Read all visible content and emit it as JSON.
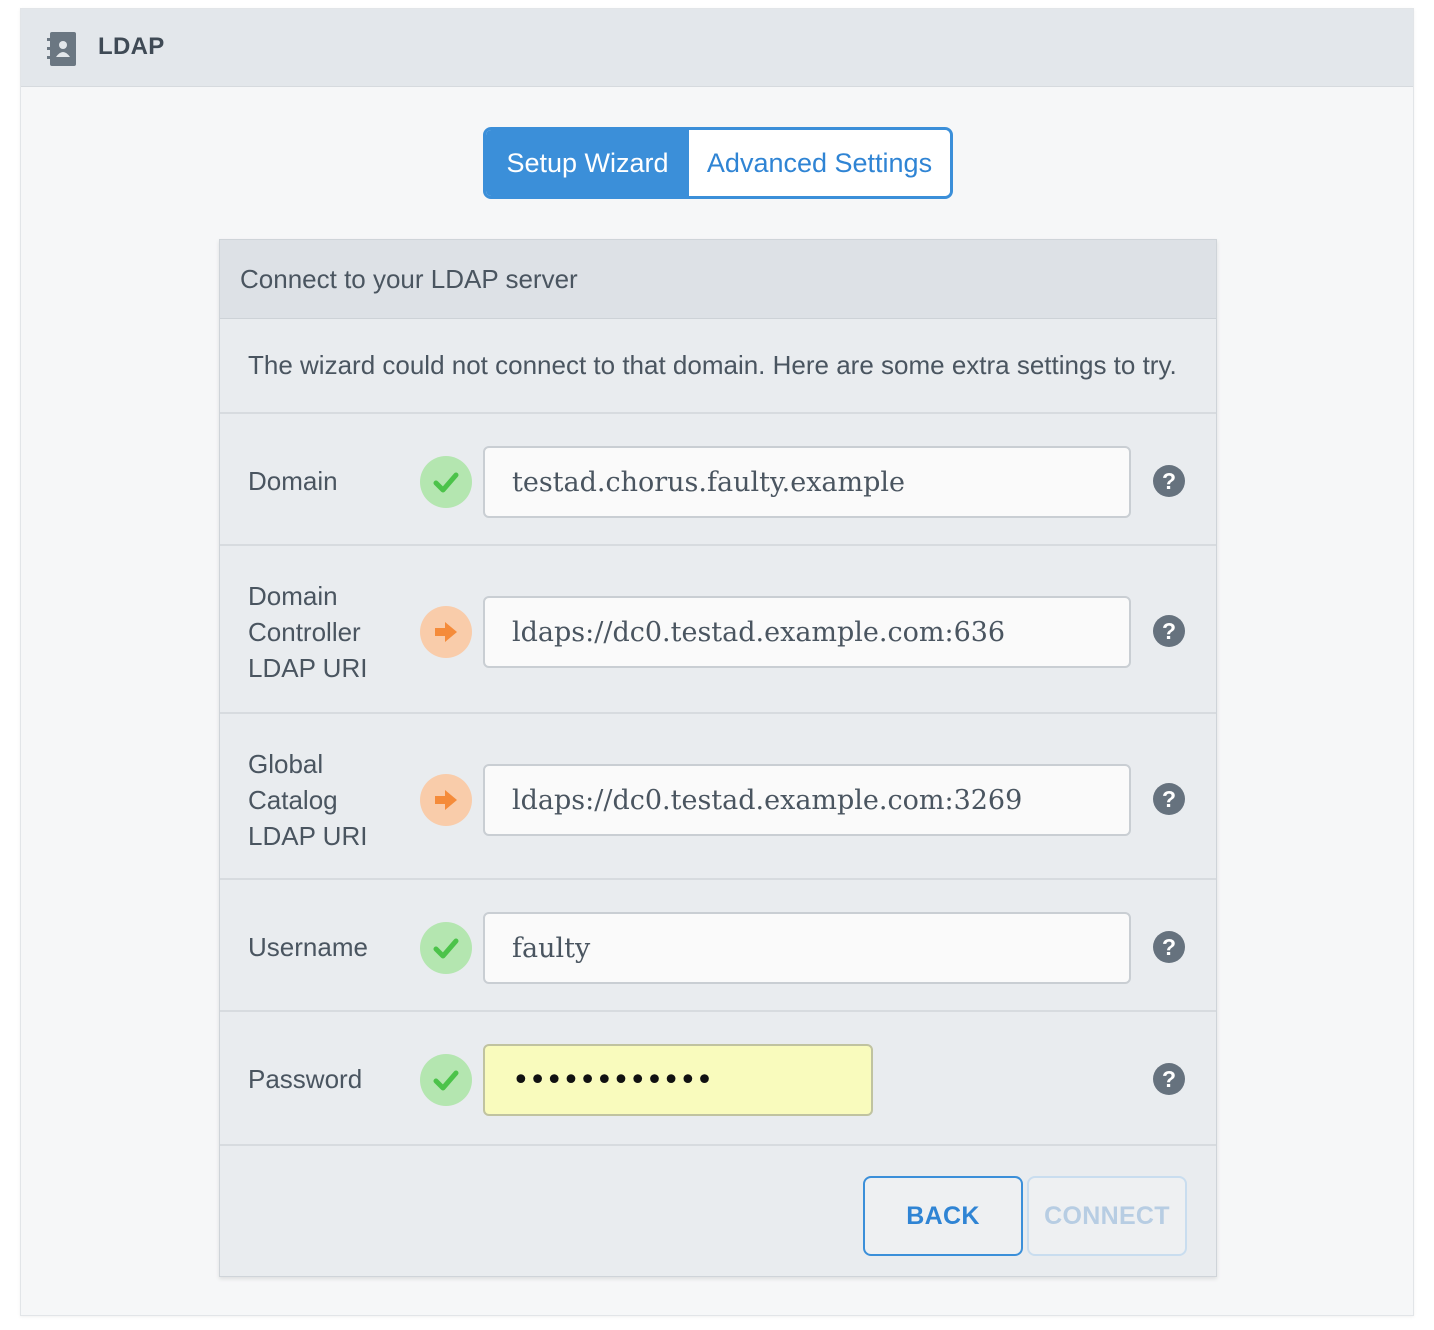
{
  "header": {
    "title": "LDAP",
    "icon": "address-book-icon"
  },
  "tabs": {
    "active_label": "Setup Wizard",
    "inactive_label": "Advanced Settings"
  },
  "panel": {
    "title": "Connect to your LDAP server",
    "message": "The wizard could not connect to that domain. Here are some extra settings to try."
  },
  "fields": {
    "domain": {
      "label": "Domain",
      "value": "testad.chorus.faulty.example",
      "status": "ok"
    },
    "dc_uri": {
      "label_lines": [
        "Domain",
        "Controller",
        "LDAP URI"
      ],
      "value": "ldaps://dc0.testad.example.com:636",
      "status": "warn"
    },
    "gc_uri": {
      "label_lines": [
        "Global",
        "Catalog",
        "LDAP URI"
      ],
      "value": "ldaps://dc0.testad.example.com:3269",
      "status": "warn"
    },
    "username": {
      "label": "Username",
      "value": "faulty",
      "status": "ok"
    },
    "password": {
      "label": "Password",
      "value": "••••••••••••",
      "status": "ok"
    }
  },
  "buttons": {
    "back": "BACK",
    "connect": "CONNECT"
  },
  "colors": {
    "accent": "#3b8fd9",
    "ok": "#4cc34a",
    "warn": "#f58b3a",
    "autofill": "#f9fbbd"
  }
}
